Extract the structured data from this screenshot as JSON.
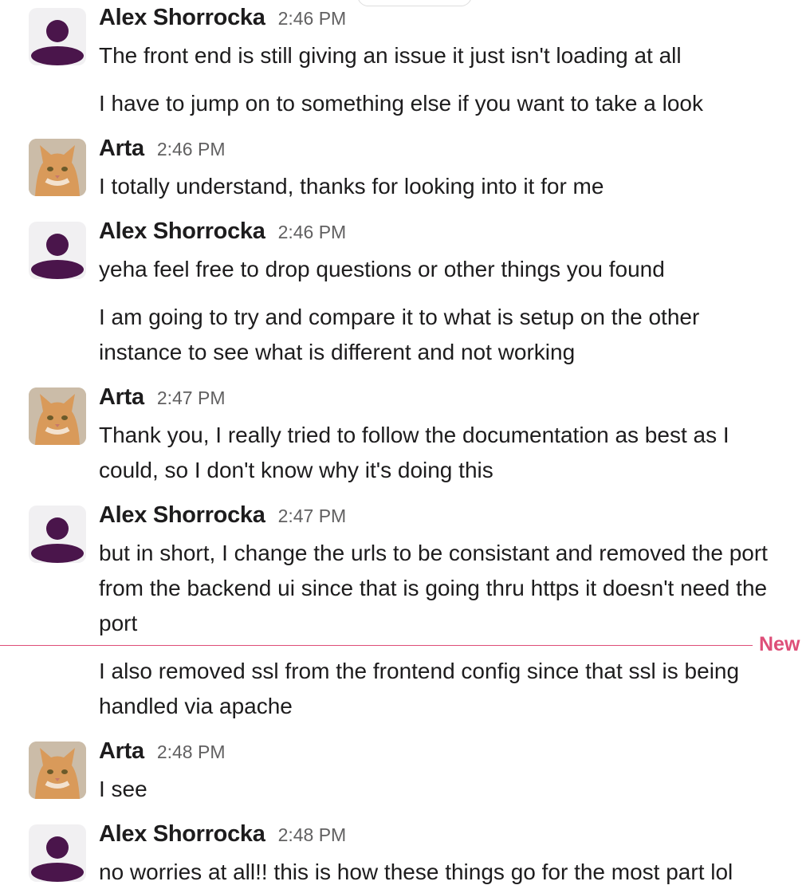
{
  "new_divider_label": "New",
  "colors": {
    "avatar_purple": "#4a154b",
    "new_divider": "#de4e78",
    "timestamp": "#616061",
    "text": "#1d1c1d"
  },
  "messages": [
    {
      "sender": "Alex Shorrocka",
      "avatar": "generic-person-icon",
      "time": "2:46 PM",
      "lines": [
        "The front end is still giving an issue it just isn't loading at all",
        "I have to jump on to something else if you want to take a look"
      ]
    },
    {
      "sender": "Arta",
      "avatar": "cat-photo",
      "time": "2:46 PM",
      "lines": [
        "I totally understand, thanks for looking into it for me"
      ]
    },
    {
      "sender": "Alex Shorrocka",
      "avatar": "generic-person-icon",
      "time": "2:46 PM",
      "lines": [
        "yeha feel free to drop questions or other things you found",
        "I am going to try and compare it to what is setup on the other instance to see what is different and not working"
      ]
    },
    {
      "sender": "Arta",
      "avatar": "cat-photo",
      "time": "2:47 PM",
      "lines": [
        "Thank you, I really tried to follow the documentation as best as I could, so I don't know why it's doing this"
      ]
    },
    {
      "sender": "Alex Shorrocka",
      "avatar": "generic-person-icon",
      "time": "2:47 PM",
      "lines": [
        "but in short, I change the urls to be consistant and removed the port from the backend ui since that is going thru https it doesn't need the port",
        "I also removed ssl from the frontend config since that ssl is being handled via apache"
      ]
    },
    {
      "sender": "Arta",
      "avatar": "cat-photo",
      "time": "2:48 PM",
      "lines": [
        "I see"
      ]
    },
    {
      "sender": "Alex Shorrocka",
      "avatar": "generic-person-icon",
      "time": "2:48 PM",
      "lines": [
        "no worries at all!! this is how these things go for the most part lol"
      ]
    }
  ]
}
